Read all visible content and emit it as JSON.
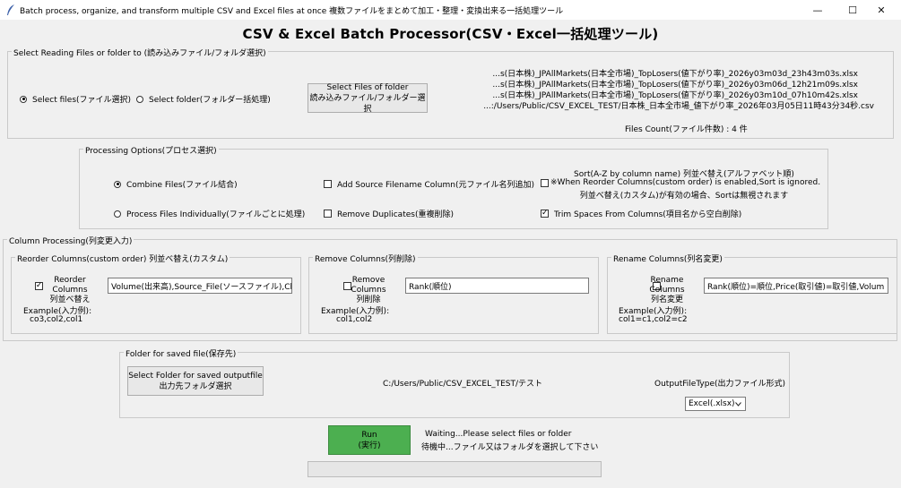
{
  "window": {
    "title": "Batch process, organize, and transform multiple CSV and Excel files at once 複数ファイルをまとめて加工・整理・変換出来る一括処理ツール",
    "minimize": "—",
    "maximize": "☐",
    "close": "✕"
  },
  "app_title": "CSV & Excel Batch Processor(CSV・Excel一括処理ツール)",
  "reading": {
    "legend": "Select Reading Files or folder to (読み込みファイル/フォルダ選択)",
    "select_files": "Select files(ファイル選択)",
    "select_folder": "Select folder(フォルダー括処理)",
    "button": "Select Files of folder\n読み込みファイル/フォルダー選択",
    "files": [
      "...s(日本株)_JPAllMarkets(日本全市場)_TopLosers(値下がり率)_2026y03m03d_23h43m03s.xlsx",
      "...s(日本株)_JPAllMarkets(日本全市場)_TopLosers(値下がり率)_2026y03m06d_12h21m09s.xlsx",
      "...s(日本株)_JPAllMarkets(日本全市場)_TopLosers(値下がり率)_2026y03m10d_07h10m42s.xlsx",
      "...:/Users/Public/CSV_EXCEL_TEST/日本株_日本全市場_値下がり率_2026年03月05日11時43分34秒.csv"
    ],
    "files_count": "Files Count(ファイル件数) : 4 件"
  },
  "processing": {
    "legend": "Processing Options(プロセス選択)",
    "combine": "Combine Files(ファイル結合)",
    "individual": "Process Files Individually(ファイルごとに処理)",
    "add_source": "Add Source Filename Column(元ファイル名列追加)",
    "remove_dup": "Remove Duplicates(重複削除)",
    "sort_title": "Sort(A-Z by column name) 列並べ替え(アルファベット順)",
    "sort_note1": "※When Reorder Columns(custom order) is enabled,Sort is ignored.",
    "sort_note2": "列並べ替え(カスタム)が有効の場合、Sortは無視されます",
    "trim": "Trim Spaces From Columns(項目名から空白削除)"
  },
  "column": {
    "legend": "Column Processing(列変更入力)",
    "reorder": {
      "legend": "Reorder Columns(custom order) 列並べ替え(カスタム)",
      "label": "Reorder Columns\n列並べ替え",
      "value": "Volume(出来高),Source_File(ソースファイル),Char",
      "example_label": "Example(入力例):",
      "example": "co3,col2,col1"
    },
    "remove": {
      "legend": "Remove Columns(列削除)",
      "label": "Remove Columns\n列削除",
      "value": "Rank(順位)",
      "example_label": "Example(入力例):",
      "example": "col1,col2"
    },
    "rename": {
      "legend": "Rename Columns(列名変更)",
      "label": "Rename Columns\n列名変更",
      "value": "Rank(順位)=順位,Price(取引値)=取引値,Volum",
      "example_label": "Example(入力例):",
      "example": "col1=c1,col2=c2"
    }
  },
  "saved": {
    "legend": "Folder for saved file(保存先)",
    "button": "Select Folder for saved outputfile\n出力先フォルダ選択",
    "path": "C:/Users/Public/CSV_EXCEL_TEST/テスト",
    "output_type_label": "OutputFileType(出力ファイル形式)",
    "output_type": "Excel(.xlsx)"
  },
  "run": {
    "button": "Run\n(実行)",
    "status1": "Waiting...Please select files or folder",
    "status2": "待機中...ファイル又はフォルダを選択して下さい"
  },
  "colors": {
    "run_button": "#4caf50",
    "border": "#c9c9c9",
    "background": "#f0f0f0"
  }
}
